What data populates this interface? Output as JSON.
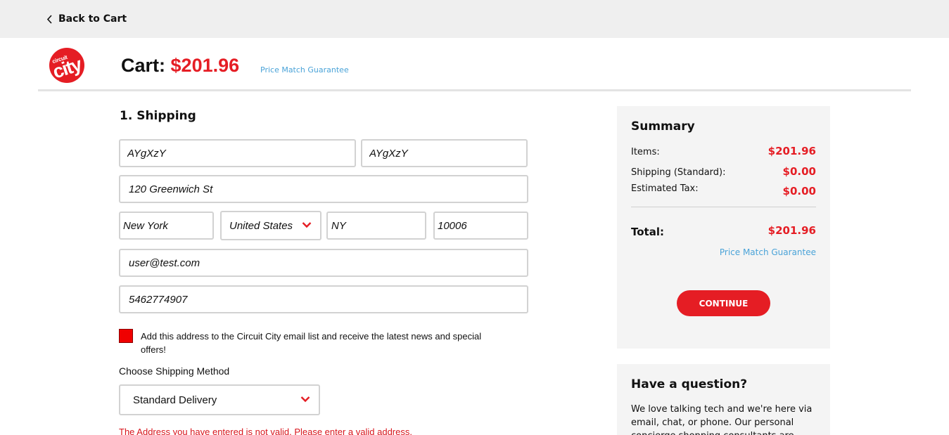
{
  "header": {
    "back_label": "Back to Cart",
    "back_icon": "chevron-left-icon"
  },
  "brand": {
    "logo_small_text": "circuit",
    "logo_big_text": "city",
    "color": "#e51d24"
  },
  "cart": {
    "label": "Cart:",
    "amount": "$201.96",
    "price_match": "Price Match Guarantee"
  },
  "shipping": {
    "section_title": "1. Shipping",
    "first_name": "AYgXzY",
    "last_name": "AYgXzY",
    "address": "120 Greenwich St",
    "city": "New York",
    "country": "United States",
    "state": "NY",
    "zip": "10006",
    "email": "user@test.com",
    "phone": "5462774907",
    "newsletter_label": "Add this address to the Circuit City email list and receive the latest news and special offers!",
    "newsletter_checked": true,
    "method_label": "Choose Shipping Method",
    "method_value": "Standard Delivery",
    "error": "The Address you have entered is not valid. Please enter a valid address."
  },
  "summary": {
    "title": "Summary",
    "items_label": "Items:",
    "items_value": "$201.96",
    "shipping_label": "Shipping (Standard):",
    "shipping_value": "$0.00",
    "tax_label": "Estimated Tax:",
    "tax_value": "$0.00",
    "total_label": "Total:",
    "total_value": "$201.96",
    "price_match": "Price Match Guarantee",
    "continue_label": "CONTINUE"
  },
  "help": {
    "title": "Have a question?",
    "body": "We love talking tech and we're here via email, chat, or phone. Our personal concierge shopping consultants are"
  },
  "colors": {
    "accent": "#e51d24",
    "link": "#4aa3d8",
    "panel": "#f4f4f4",
    "topbar": "#efefef"
  }
}
